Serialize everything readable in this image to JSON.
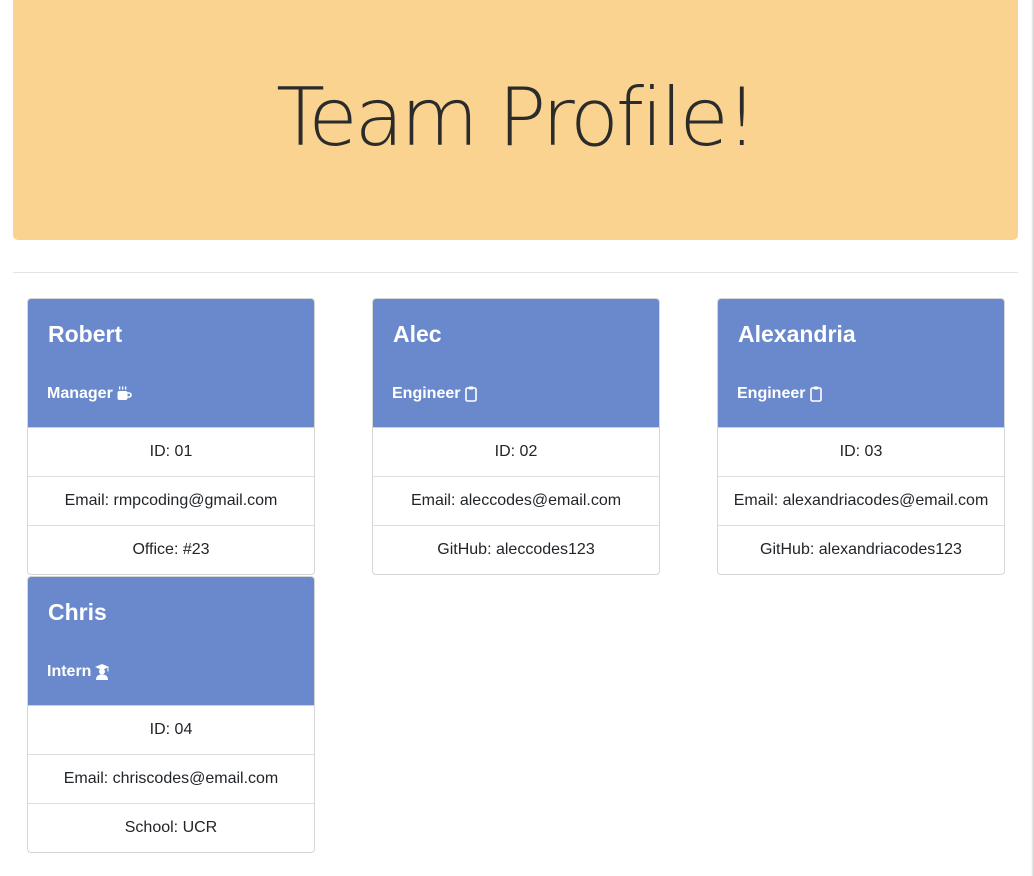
{
  "header": {
    "title": "Team Profile!"
  },
  "team": [
    {
      "name": "Robert",
      "role": "Manager",
      "role_icon": "mug-icon",
      "details": [
        "ID: 01",
        "Email: rmpcoding@gmail.com",
        "Office: #23"
      ]
    },
    {
      "name": "Alec",
      "role": "Engineer",
      "role_icon": "clipboard-icon",
      "details": [
        "ID: 02",
        "Email: aleccodes@email.com",
        "GitHub: aleccodes123"
      ]
    },
    {
      "name": "Alexandria",
      "role": "Engineer",
      "role_icon": "clipboard-icon",
      "details": [
        "ID: 03",
        "Email: alexandriacodes@email.com",
        "GitHub: alexandriacodes123"
      ]
    },
    {
      "name": "Chris",
      "role": "Intern",
      "role_icon": "graduate-icon",
      "details": [
        "ID: 04",
        "Email: chriscodes@email.com",
        "School: UCR"
      ]
    }
  ],
  "colors": {
    "jumbotron_bg": "#f9d38f",
    "card_header_bg": "#6a89cc"
  }
}
